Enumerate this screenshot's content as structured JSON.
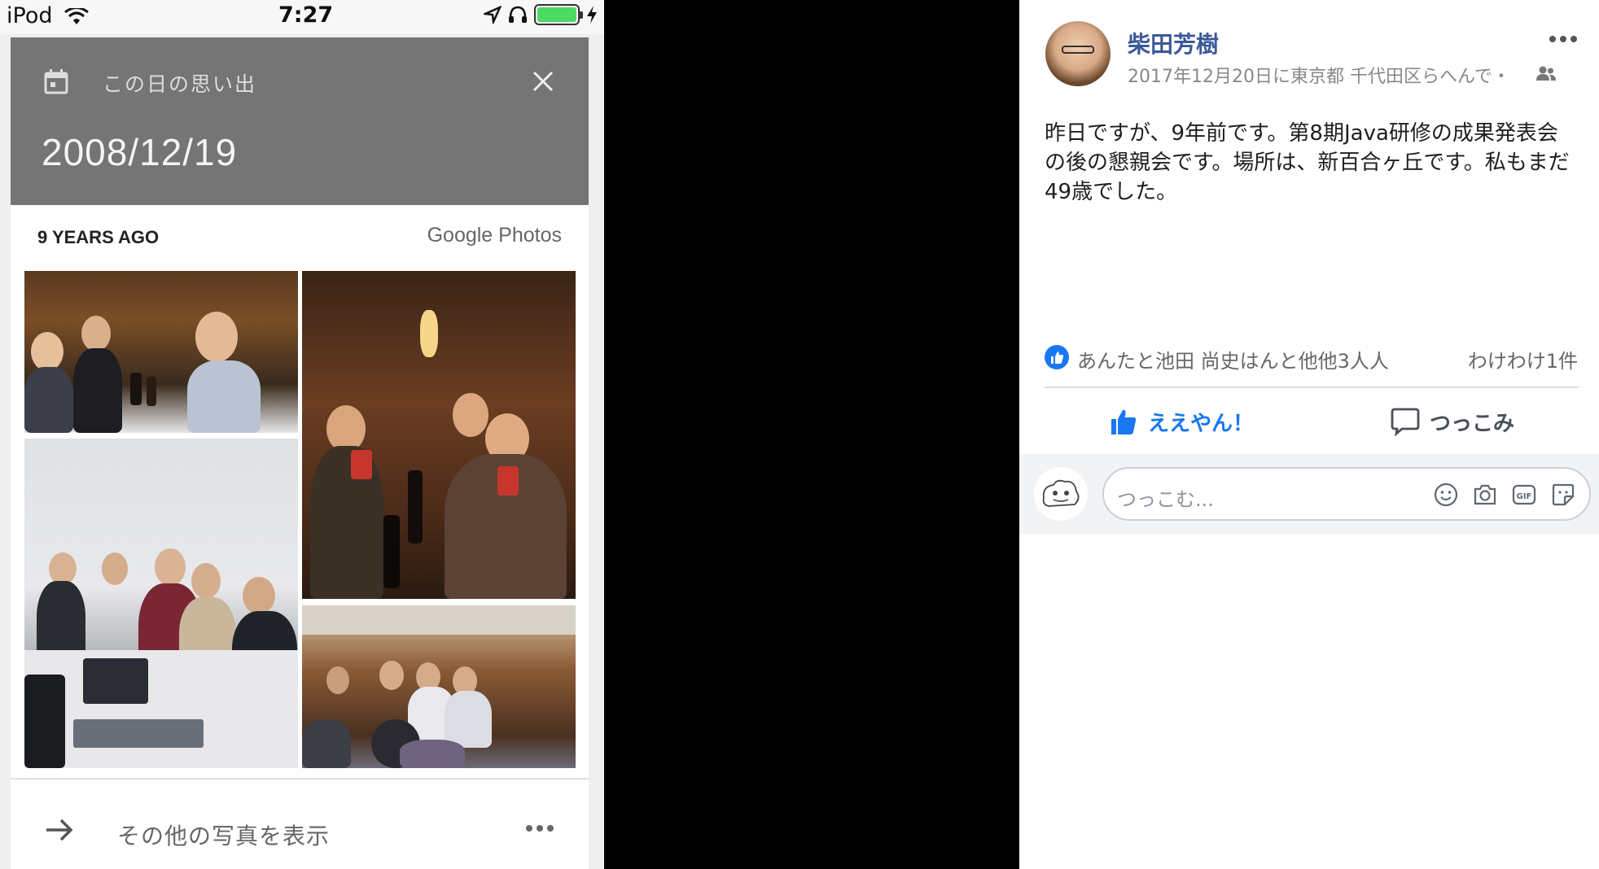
{
  "status_bar": {
    "device": "iPod",
    "time": "7:27",
    "battery_color": "#4cd964"
  },
  "memory_card": {
    "header_label": "この日の思い出",
    "date": "2008/12/19",
    "years_ago": "9 YEARS AGO",
    "brand": "Google Photos",
    "more_photos_label": "その他の写真を表示",
    "header_bg": "#757575",
    "icons": [
      "calendar-icon",
      "close-icon",
      "arrow-right-icon",
      "more-dots-icon"
    ]
  },
  "post": {
    "author": "柴田芳樹",
    "meta": "2017年12月20日に東京都 千代田区らへんで・",
    "body": "昨日ですが、9年前です。第8期Java研修の成果発表会の後の懇親会です。場所は、新百合ヶ丘です。私もまだ49歳でした。",
    "reactions_text": "あんたと池田 尚史はんと他他3人人",
    "comments_count": "わけわけ1件",
    "like_label": "ええやん！",
    "comment_label": "つっこみ",
    "comment_placeholder": "つっこむ...",
    "link_color": "#3b5998",
    "like_color": "#1877f2"
  }
}
